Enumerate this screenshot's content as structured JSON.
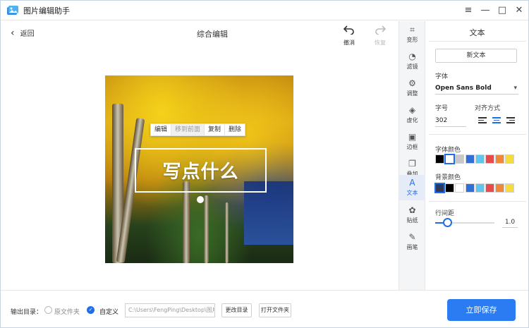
{
  "app": {
    "title": "图片编辑助手"
  },
  "window_controls": {
    "menu": "≡",
    "minimize": "—",
    "maximize": "□",
    "close": "✕"
  },
  "header": {
    "back_label": "返回",
    "page_title": "综合编辑",
    "undo_label": "撤消",
    "redo_label": "恢复"
  },
  "canvas": {
    "popup": [
      "编辑",
      "移到前面",
      "复制",
      "删除"
    ],
    "text_box_text": "写点什么"
  },
  "tools": [
    {
      "label": "变形",
      "icon": "crop-icon",
      "glyph": "⌗"
    },
    {
      "label": "滤镜",
      "icon": "drop-icon",
      "glyph": "◔"
    },
    {
      "label": "调整",
      "icon": "adjust-icon",
      "glyph": "⚙"
    },
    {
      "label": "虚化",
      "icon": "blur-icon",
      "glyph": "◈"
    },
    {
      "label": "边框",
      "icon": "frame-icon",
      "glyph": "▣"
    },
    {
      "label": "叠加",
      "icon": "overlay-icon",
      "glyph": "❐"
    },
    {
      "label": "文本",
      "icon": "text-icon",
      "glyph": "A",
      "active": true
    },
    {
      "label": "贴纸",
      "icon": "sticker-icon",
      "glyph": "✿"
    },
    {
      "label": "画笔",
      "icon": "brush-icon",
      "glyph": "✎"
    }
  ],
  "panel": {
    "title": "文本",
    "new_text": "新文本",
    "font_label": "字体",
    "font_value": "Open Sans Bold",
    "size_label": "字号",
    "size_value": "302",
    "align_label": "对齐方式",
    "font_color_label": "字体颜色",
    "bg_color_label": "背景颜色",
    "line_height_label": "行间距",
    "line_height_value": "1.0",
    "line_height_level": 0.2,
    "font_colors": [
      "#000000",
      "#ffffff",
      "#c8c8c8",
      "#2e6fd9",
      "#5fc6f0",
      "#e94a4a",
      "#f0883a",
      "#f5dc3a"
    ],
    "font_color_selected": 1,
    "bg_colors": [
      "#2d3a5a",
      "#000000",
      "#ffffff",
      "#2e6fd9",
      "#5fc6f0",
      "#e94a4a",
      "#f0883a",
      "#f5dc3a"
    ],
    "bg_color_selected": 0
  },
  "footer": {
    "output_label": "输出目录：",
    "option_original": "原文件夹",
    "option_custom": "自定义",
    "path_value": "C:\\Users\\FengPing\\Desktop\\图片",
    "change_dir": "更改目录",
    "open_folder": "打开文件夹",
    "save": "立即保存"
  }
}
